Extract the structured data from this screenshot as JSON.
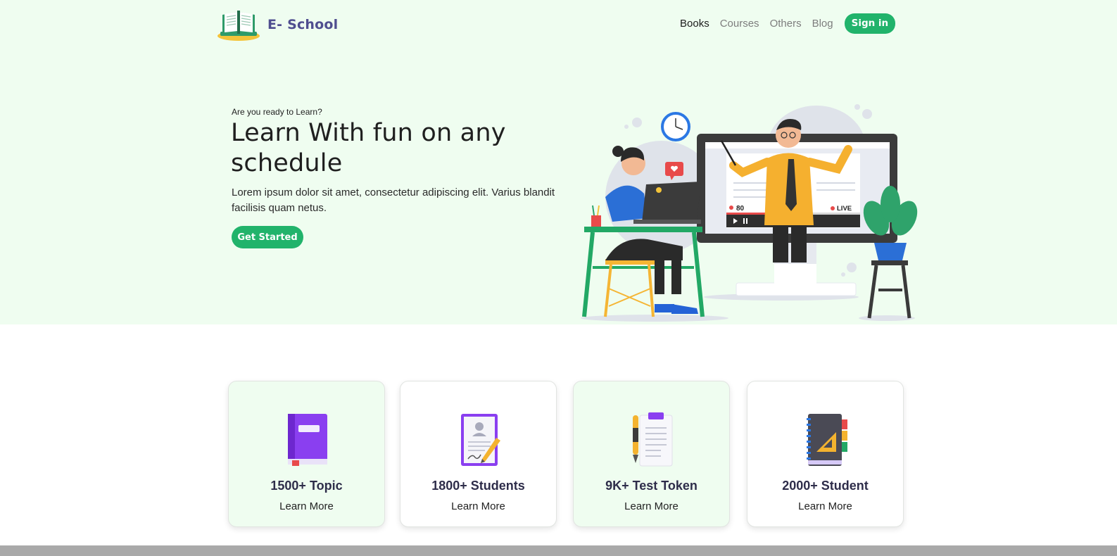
{
  "brand": {
    "name": "E- School",
    "logo_icon": "open-book-icon"
  },
  "nav": {
    "items": [
      {
        "label": "Books",
        "active": true
      },
      {
        "label": "Courses",
        "active": false
      },
      {
        "label": "Others",
        "active": false
      },
      {
        "label": "Blog",
        "active": false
      }
    ],
    "signin_label": "Sign in"
  },
  "hero": {
    "eyebrow": "Are you ready to Learn?",
    "title": "Learn With fun on any schedule",
    "description": "Lorem ipsum dolor sit amet, consectetur adipiscing elit. Varius blandit facilisis quam netus.",
    "cta_label": "Get Started",
    "illustration": {
      "viewer_count": "80",
      "live_label": "LIVE"
    }
  },
  "stats": [
    {
      "title": "1500+ Topic",
      "link": "Learn More",
      "icon": "purple-book-icon",
      "tinted": true
    },
    {
      "title": "1800+ Students",
      "link": "Learn More",
      "icon": "certificate-icon",
      "tinted": false
    },
    {
      "title": "9K+ Test Token",
      "link": "Learn More",
      "icon": "clipboard-pen-icon",
      "tinted": true
    },
    {
      "title": "2000+ Student",
      "link": "Learn More",
      "icon": "notebook-ruler-icon",
      "tinted": false
    }
  ],
  "colors": {
    "accent": "#21b36b",
    "hero_bg": "#effdf0",
    "brand_text": "#4f4e8f"
  }
}
